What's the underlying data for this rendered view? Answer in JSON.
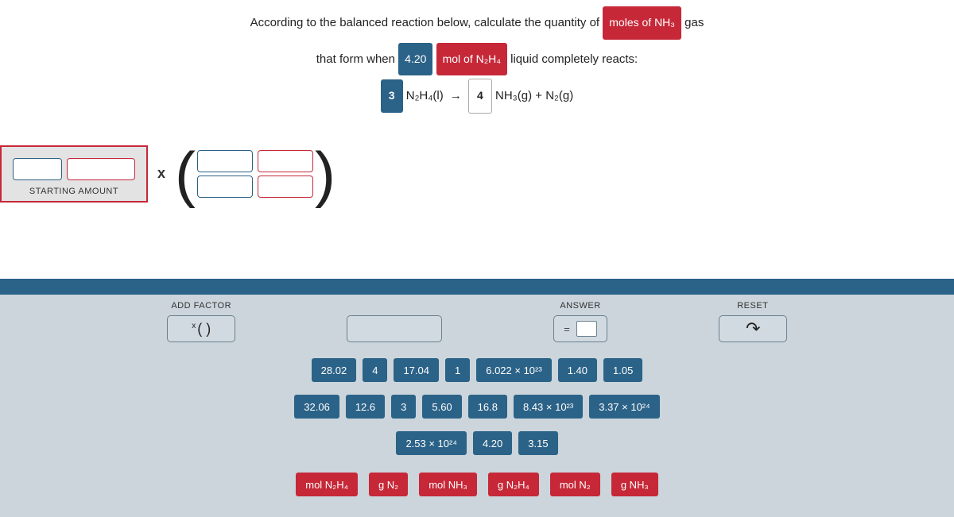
{
  "question": {
    "prefix1": "According to the balanced reaction below, calculate the quantity of",
    "target": "moles of NH₃",
    "suffix1": "gas",
    "prefix2": "that form when",
    "amount": "4.20",
    "amount_unit": "mol of N₂H₄",
    "suffix2": "liquid completely reacts:",
    "coef1": "3",
    "reactant": "N₂H₄(l)",
    "arrow": "→",
    "coef2": "4",
    "products": "NH₃(g) + N₂(g)"
  },
  "setup": {
    "starting_label": "STARTING AMOUNT",
    "times": "x"
  },
  "controls": {
    "add_factor_label": "ADD FACTOR",
    "add_factor_text": "(   )",
    "add_factor_prefix": "x",
    "answer_label": "ANSWER",
    "answer_eq": "=",
    "reset_label": "RESET",
    "reset_icon": "↶"
  },
  "number_tiles": [
    "28.02",
    "4",
    "17.04",
    "1",
    "6.022 × 10²³",
    "1.40",
    "1.05",
    "32.06",
    "12.6",
    "3",
    "5.60",
    "16.8",
    "8.43 × 10²³",
    "3.37 × 10²⁴",
    "2.53 × 10²⁴",
    "4.20",
    "3.15"
  ],
  "unit_tiles": [
    "mol N₂H₄",
    "g N₂",
    "mol NH₃",
    "g N₂H₄",
    "mol N₂",
    "g NH₃"
  ]
}
